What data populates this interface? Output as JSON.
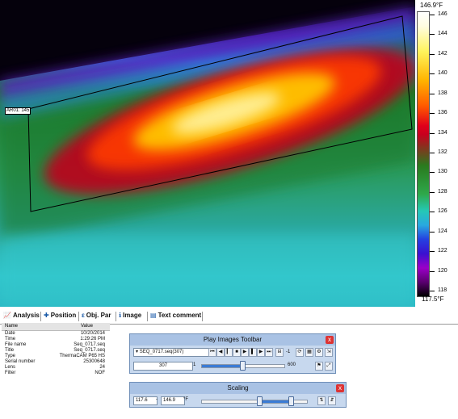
{
  "thermal": {
    "roi_label": "AR01: 145"
  },
  "scale": {
    "max_label": "146.9°F",
    "min_label": "117.5°F",
    "ticks": [
      "146",
      "144",
      "142",
      "140",
      "138",
      "136",
      "134",
      "132",
      "130",
      "128",
      "126",
      "124",
      "122",
      "120",
      "118"
    ]
  },
  "tabs": [
    {
      "label": "Analysis",
      "icon": "analysis-icon"
    },
    {
      "label": "Position",
      "icon": "position-icon"
    },
    {
      "label": "Obj. Par",
      "icon": "object-parameters-icon"
    },
    {
      "label": "Image",
      "icon": "info-icon"
    },
    {
      "label": "Text comment",
      "icon": "text-comment-icon"
    }
  ],
  "info": {
    "header_name": "Name",
    "header_value": "Value",
    "rows": [
      {
        "k": "Date",
        "v": "10/20/2014"
      },
      {
        "k": "Time",
        "v": "1:29:26 PM"
      },
      {
        "k": "File name",
        "v": "Seq_0717.seq"
      },
      {
        "k": "Title",
        "v": "Seq_0717.seq"
      },
      {
        "k": "Type",
        "v": "ThermaCAM P65 HS"
      },
      {
        "k": "Serial number",
        "v": "25300648"
      },
      {
        "k": "Lens",
        "v": "24"
      },
      {
        "k": "Filter",
        "v": "NOF"
      }
    ]
  },
  "play_toolbar": {
    "title": "Play Images Toolbar",
    "sequence": "SEQ_0717.seq(307)",
    "frame": "307",
    "range_start": "1",
    "range_end": "600",
    "speed": "-1",
    "position_fraction": 0.5,
    "close": "x"
  },
  "scaling": {
    "title": "Scaling",
    "min_value": "117.6",
    "max_value": "146.9",
    "unit": "°F",
    "dash": "-",
    "low_fraction": 0.55,
    "high_fraction": 0.85,
    "close": "x"
  }
}
